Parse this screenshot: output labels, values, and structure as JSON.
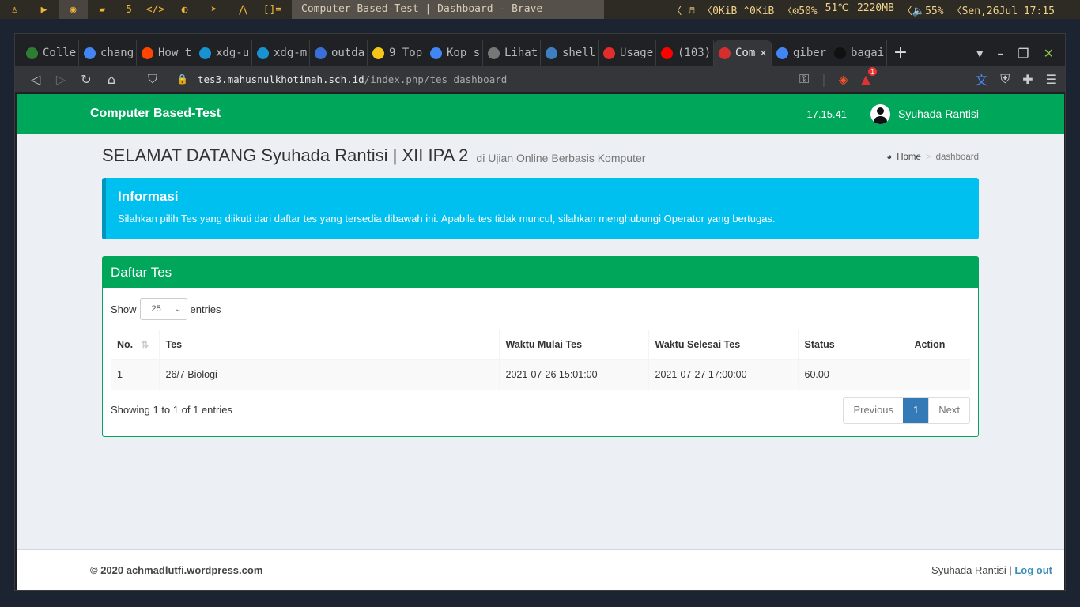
{
  "sysbar": {
    "workspaces": [
      "5"
    ],
    "layout": "[]=",
    "window_title": "Computer Based-Test | Dashboard - Brave",
    "net": "0KiB ^0KiB",
    "cpu": "50%",
    "temp": "51℃",
    "mem": "2220MB",
    "volume": "55%",
    "datetime": "Sen,26Jul 17:15"
  },
  "browser": {
    "tabs": [
      {
        "label": "Colle",
        "color": "#2e7d32"
      },
      {
        "label": "chang",
        "color": "#4285f4"
      },
      {
        "label": "How t",
        "color": "#ff4500"
      },
      {
        "label": "xdg-u",
        "color": "#1793d1"
      },
      {
        "label": "xdg-m",
        "color": "#1793d1"
      },
      {
        "label": "outda",
        "color": "#3a6fd8"
      },
      {
        "label": "9 Top",
        "color": "#f5c518"
      },
      {
        "label": "Kop s",
        "color": "#4285f4"
      },
      {
        "label": "Lihat",
        "color": "#777777"
      },
      {
        "label": "shell",
        "color": "#3d7fc1"
      },
      {
        "label": "Usage",
        "color": "#e32c2c"
      },
      {
        "label": "(103)",
        "color": "#ff0000"
      },
      {
        "label": "Com",
        "color": "#d32f2f"
      },
      {
        "label": "giber",
        "color": "#4285f4"
      },
      {
        "label": "bagai",
        "color": "#111111"
      }
    ],
    "active_tab": 12,
    "url_host": "tes3.mahusnulkhotimah.sch.id",
    "url_path": "/index.php/tes_dashboard",
    "notification_count": "1"
  },
  "app": {
    "brand": "Computer Based-Test",
    "clock": "17.15.41",
    "user_name": "Syuhada Rantisi"
  },
  "content": {
    "title": "SELAMAT DATANG Syuhada Rantisi | XII IPA 2",
    "subtitle": "di Ujian Online Berbasis Komputer",
    "breadcrumb_home": "Home",
    "breadcrumb_current": "dashboard"
  },
  "callout": {
    "title": "Informasi",
    "text": "Silahkan pilih Tes yang diikuti dari daftar tes yang tersedia dibawah ini. Apabila tes tidak muncul, silahkan menghubungi Operator yang bertugas."
  },
  "daftar": {
    "title": "Daftar Tes",
    "show_label": "Show",
    "entries_label": "entries",
    "page_size": "25",
    "columns": [
      "No.",
      "Tes",
      "Waktu Mulai Tes",
      "Waktu Selesai Tes",
      "Status",
      "Action"
    ],
    "rows": [
      {
        "no": "1",
        "tes": "26/7 Biologi",
        "mulai": "2021-07-26 15:01:00",
        "selesai": "2021-07-27 17:00:00",
        "status": "60.00",
        "action": ""
      }
    ],
    "info": "Showing 1 to 1 of 1 entries",
    "prev": "Previous",
    "page": "1",
    "next": "Next"
  },
  "footer": {
    "copyright": "© 2020 achmadlutfi.wordpress.com",
    "user": "Syuhada Rantisi |",
    "logout": "Log out"
  }
}
